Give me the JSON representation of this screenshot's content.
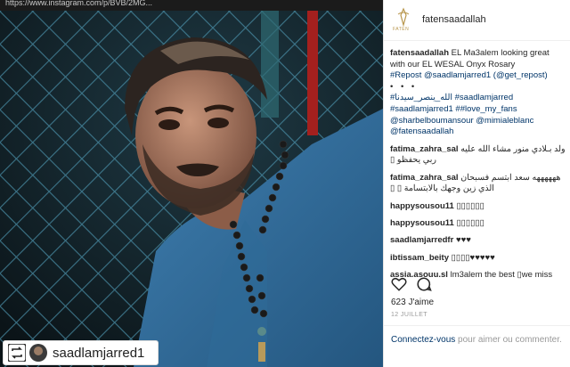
{
  "browser": {
    "url": "https://www.instagram.com/p/BVB/2MG..."
  },
  "post": {
    "photo_label": "photo",
    "repost_user": "saadlamjarred1",
    "header_user": "fatensaadallah",
    "logo_text": "FATEN",
    "caption": {
      "user": "fatensaadallah",
      "text": "EL Ma3alem looking great with our EL WESAL Onyx Rosary",
      "repost_tag": "#Repost",
      "repost_mention": "@saadlamjarred1",
      "get_repost": "(@get_repost)",
      "dots": "• • •",
      "hashtag_ar": "#الله_ينصر_سيدنا",
      "hashtag_saad": "#saadlamjarred",
      "hashtag_saad2": "#saadlamjarred1",
      "hashtag_fans": "##love_my_fans",
      "mention_sharbel": "@sharbelboumansour",
      "mention_mimia": "@mimialeblanc",
      "mention_faten": "@fatensaadallah"
    },
    "comments": [
      {
        "user": "fatima_zahra_sal",
        "text": "ولد بـلادي منور مشاء الله عليه ربي يحفظو ▯"
      },
      {
        "user": "fatima_zahra_sal",
        "text": "ههههههه سعد ابتسم فسبحان الذي زين وجهك بالابتسامة ▯ ▯"
      },
      {
        "user": "happysousou11",
        "text": "▯▯▯▯▯▯"
      },
      {
        "user": "happysousou11",
        "text": "▯▯▯▯▯▯"
      },
      {
        "user": "saadlamjarredfr",
        "text": "♥♥♥"
      },
      {
        "user": "ibtissam_beity",
        "text": "▯▯▯▯♥♥♥♥♥"
      },
      {
        "user": "assia.asouu.sl",
        "text": "lm3alem the best ▯we miss"
      }
    ],
    "likes": "623 J'aime",
    "date": "12 JUILLET",
    "login_link": "Connectez-vous",
    "login_rest": " pour aimer ou commenter."
  }
}
